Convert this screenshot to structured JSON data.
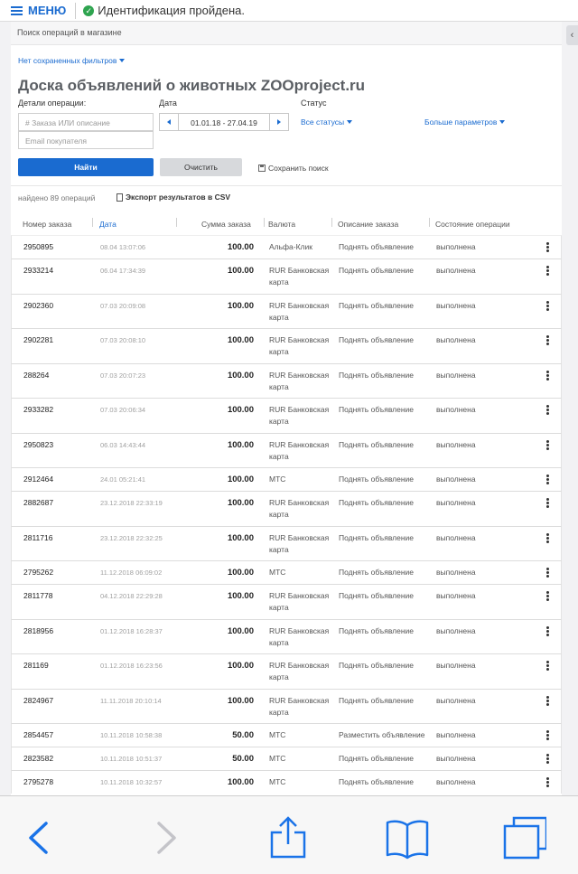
{
  "topbar": {
    "menu_label": "МЕНЮ",
    "status_text": "Идентификация пройдена."
  },
  "breadcrumb": "Поиск операций в магазине",
  "filters_link": "Нет сохраненных фильтров",
  "title": "Доска объявлений о животных ZOOproject.ru",
  "form": {
    "details_label": "Детали операции:",
    "order_placeholder": "# Заказа ИЛИ описание",
    "email_placeholder": "Email покупателя",
    "date_label": "Дата",
    "date_range": "01.01.18 - 27.04.19",
    "status_label": "Статус",
    "status_value": "Все статусы",
    "more_params": "Больше параметров",
    "find_button": "Найти",
    "clear_button": "Очистить",
    "save_search": "Сохранить поиск"
  },
  "results": {
    "found_text": "найдено 89 операций",
    "export_text": "Экспорт результатов в CSV"
  },
  "table": {
    "columns": [
      "Номер заказа",
      "Дата",
      "Сумма заказа",
      "Валюта",
      "Описание заказа",
      "Состояние операции"
    ],
    "rows": [
      {
        "id": "2950895",
        "date": "08.04 13:07:06",
        "sum": "100.00",
        "currency": "Альфа-Клик",
        "desc": "Поднять объявление",
        "state": "выполнена"
      },
      {
        "id": "2933214",
        "date": "06.04 17:34:39",
        "sum": "100.00",
        "currency": "RUR Банковская карта",
        "desc": "Поднять объявление",
        "state": "выполнена"
      },
      {
        "id": "2902360",
        "date": "07.03 20:09:08",
        "sum": "100.00",
        "currency": "RUR Банковская карта",
        "desc": "Поднять объявление",
        "state": "выполнена"
      },
      {
        "id": "2902281",
        "date": "07.03 20:08:10",
        "sum": "100.00",
        "currency": "RUR Банковская карта",
        "desc": "Поднять объявление",
        "state": "выполнена"
      },
      {
        "id": "288264",
        "date": "07.03 20:07:23",
        "sum": "100.00",
        "currency": "RUR Банковская карта",
        "desc": "Поднять объявление",
        "state": "выполнена"
      },
      {
        "id": "2933282",
        "date": "07.03 20:06:34",
        "sum": "100.00",
        "currency": "RUR Банковская карта",
        "desc": "Поднять объявление",
        "state": "выполнена"
      },
      {
        "id": "2950823",
        "date": "06.03 14:43:44",
        "sum": "100.00",
        "currency": "RUR Банковская карта",
        "desc": "Поднять объявление",
        "state": "выполнена"
      },
      {
        "id": "2912464",
        "date": "24.01 05:21:41",
        "sum": "100.00",
        "currency": "МТС",
        "desc": "Поднять объявление",
        "state": "выполнена"
      },
      {
        "id": "2882687",
        "date": "23.12.2018 22:33:19",
        "sum": "100.00",
        "currency": "RUR Банковская карта",
        "desc": "Поднять объявление",
        "state": "выполнена"
      },
      {
        "id": "2811716",
        "date": "23.12.2018 22:32:25",
        "sum": "100.00",
        "currency": "RUR Банковская карта",
        "desc": "Поднять объявление",
        "state": "выполнена"
      },
      {
        "id": "2795262",
        "date": "11.12.2018 06:09:02",
        "sum": "100.00",
        "currency": "МТС",
        "desc": "Поднять объявление",
        "state": "выполнена"
      },
      {
        "id": "2811778",
        "date": "04.12.2018 22:29:28",
        "sum": "100.00",
        "currency": "RUR Банковская карта",
        "desc": "Поднять объявление",
        "state": "выполнена"
      },
      {
        "id": "2818956",
        "date": "01.12.2018 16:28:37",
        "sum": "100.00",
        "currency": "RUR Банковская карта",
        "desc": "Поднять объявление",
        "state": "выполнена"
      },
      {
        "id": "281169",
        "date": "01.12.2018 16:23:56",
        "sum": "100.00",
        "currency": "RUR Банковская карта",
        "desc": "Поднять объявление",
        "state": "выполнена"
      },
      {
        "id": "2824967",
        "date": "11.11.2018 20:10:14",
        "sum": "100.00",
        "currency": "RUR Банковская карта",
        "desc": "Поднять объявление",
        "state": "выполнена"
      },
      {
        "id": "2854457",
        "date": "10.11.2018 10:58:38",
        "sum": "50.00",
        "currency": "МТС",
        "desc": "Разместить объявление",
        "state": "выполнена"
      },
      {
        "id": "2823582",
        "date": "10.11.2018 10:51:37",
        "sum": "50.00",
        "currency": "МТС",
        "desc": "Поднять объявление",
        "state": "выполнена"
      },
      {
        "id": "2795278",
        "date": "10.11.2018 10:32:57",
        "sum": "100.00",
        "currency": "МТС",
        "desc": "Поднять объявление",
        "state": "выполнена"
      }
    ]
  },
  "browser_toolbar": {
    "icons": [
      "back-icon",
      "forward-icon",
      "share-icon",
      "bookmarks-icon",
      "tabs-icon"
    ],
    "accent": "#1a73e8"
  }
}
